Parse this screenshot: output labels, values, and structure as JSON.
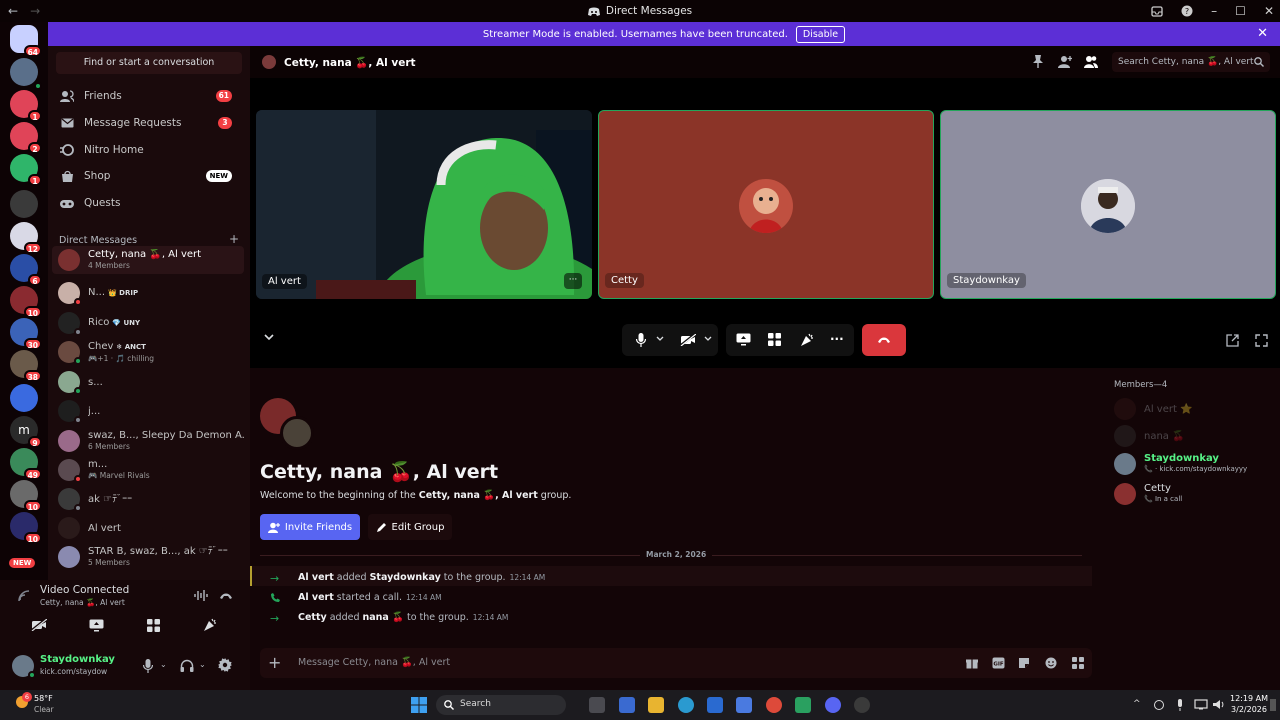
{
  "window": {
    "title": "Direct Messages",
    "nav_back": "←",
    "nav_forward": "→"
  },
  "banner": {
    "text": "Streamer Mode is enabled. Usernames have been truncated.",
    "button": "Disable"
  },
  "rail": {
    "badges": [
      "64",
      "1",
      "2",
      "1",
      "12",
      "6",
      "10",
      "30",
      "38",
      "9",
      "49",
      "10",
      "10"
    ],
    "new_label": "NEW"
  },
  "sidebar": {
    "find": "Find or start a conversation",
    "nav": [
      {
        "label": "Friends",
        "badge": "61"
      },
      {
        "label": "Message Requests",
        "badge": "3"
      },
      {
        "label": "Nitro Home",
        "badge": ""
      },
      {
        "label": "Shop",
        "badge": "NEW"
      },
      {
        "label": "Quests",
        "badge": ""
      }
    ],
    "dm_header": "Direct Messages",
    "dm_add": "+",
    "dms": [
      {
        "name": "Cetty, nana 🍒, Al vert",
        "sub": "4 Members",
        "tag": ""
      },
      {
        "name": "N...",
        "sub": "",
        "tag": "👑 DRIP"
      },
      {
        "name": "Rico",
        "sub": "",
        "tag": "💎 UNY"
      },
      {
        "name": "Chev",
        "sub": "🎮+1 · 🎵 chilling",
        "tag": "❄ ANCT"
      },
      {
        "name": "s...",
        "sub": "",
        "tag": ""
      },
      {
        "name": "j...",
        "sub": "",
        "tag": ""
      },
      {
        "name": "swaz, B..., Sleepy Da Demon A...",
        "sub": "6 Members",
        "tag": ""
      },
      {
        "name": "m...",
        "sub": "🎮 Marvel Rivals",
        "tag": ""
      },
      {
        "name": "ak ☞ﾃﾞｰｰ",
        "sub": "",
        "tag": ""
      },
      {
        "name": "Al vert",
        "sub": "",
        "tag": ""
      },
      {
        "name": "STAR B, swaz, B..., ak ☞ﾃﾞｰｰ",
        "sub": "5 Members",
        "tag": ""
      }
    ]
  },
  "voice": {
    "status": "Video Connected",
    "channel": "Cetty, nana 🍒, Al vert"
  },
  "user": {
    "name": "Staydownkay",
    "status": "kick.com/staydow"
  },
  "header": {
    "title": "Cetty, nana 🍒, Al vert",
    "search_placeholder": "Search Cetty, nana 🍒, Al vert"
  },
  "tiles": [
    {
      "label": "Al vert",
      "more": "···"
    },
    {
      "label": "Cetty"
    },
    {
      "label": "Staydownkay"
    }
  ],
  "chat": {
    "title": "Cetty, nana 🍒, Al vert",
    "welcome_prefix": "Welcome to the beginning of the ",
    "welcome_name": "Cetty, nana 🍒, Al vert",
    "welcome_suffix": " group.",
    "invite": "Invite Friends",
    "edit": "Edit Group",
    "date": "March 2, 2026",
    "messages": [
      {
        "a": "Al vert",
        "mid": " added ",
        "b": "Staydownkay",
        "end": " to the group.",
        "time": "12:14 AM"
      },
      {
        "a": "Al vert",
        "mid": " started a call.",
        "b": "",
        "end": "",
        "time": "12:14 AM"
      },
      {
        "a": "Cetty",
        "mid": " added ",
        "b": "nana 🍒",
        "end": " to the group.",
        "time": "12:14 AM"
      }
    ],
    "input_placeholder": "Message Cetty, nana 🍒, Al vert"
  },
  "members": {
    "header": "Members—4",
    "list": [
      {
        "name": "Al vert ⭐",
        "sub": ""
      },
      {
        "name": "nana 🍒",
        "sub": ""
      },
      {
        "name": "Staydownkay",
        "sub": "📞 · kick.com/staydownkayyy"
      },
      {
        "name": "Cetty",
        "sub": "📞 In a call"
      }
    ]
  },
  "taskbar": {
    "weather_temp": "58°F",
    "weather_desc": "Clear",
    "weather_badge": "6",
    "search": "Search",
    "time": "12:19 AM",
    "date": "3/2/2026"
  },
  "colors": {
    "accent": "#5865f2",
    "banner": "#5c2fd6",
    "hangup": "#da373c",
    "online": "#23a55a",
    "badge": "#f23f43",
    "streamer_name": "#57f287"
  }
}
